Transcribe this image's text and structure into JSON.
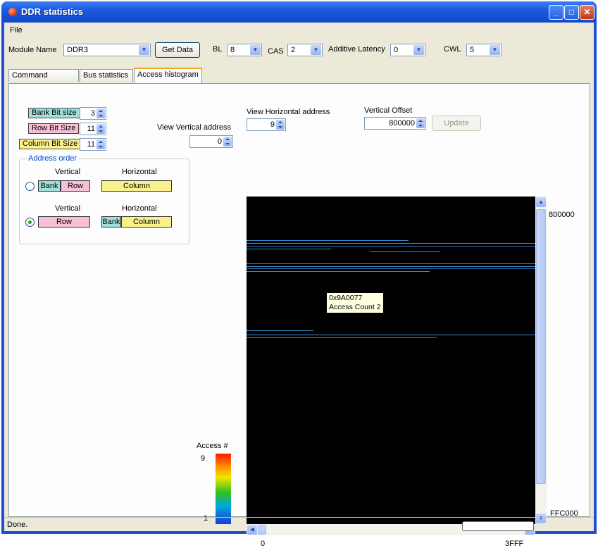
{
  "window": {
    "title": "DDR statistics"
  },
  "menu": {
    "file": "File"
  },
  "toolbar": {
    "module_label": "Module Name",
    "module_value": "DDR3",
    "get_data": "Get Data",
    "bl_label": "BL",
    "bl_value": "8",
    "cas_label": "CAS",
    "cas_value": "2",
    "al_label": "Additive Latency",
    "al_value": "0",
    "cwl_label": "CWL",
    "cwl_value": "5"
  },
  "tabs": [
    {
      "label": "Command statistics",
      "active": false
    },
    {
      "label": "Bus statistics",
      "active": false
    },
    {
      "label": "Access histogram",
      "active": true
    }
  ],
  "bits": {
    "bank_label": "Bank Bit size",
    "bank_value": "3",
    "row_label": "Row Bit Size",
    "row_value": "11",
    "col_label": "Column Bit Size",
    "col_value": "11"
  },
  "address_order": {
    "title": "Address order",
    "option1": {
      "vertical_label": "Vertical",
      "horizontal_label": "Horizontal",
      "bank": "Bank",
      "row": "Row",
      "column": "Column",
      "selected": false
    },
    "option2": {
      "vertical_label": "Vertical",
      "horizontal_label": "Horizontal",
      "row": "Row",
      "bank": "Bank",
      "column": "Column",
      "selected": true
    }
  },
  "view": {
    "vertical_label": "View Vertical address",
    "vertical_value": "0",
    "horizontal_label": "View Horizontal address",
    "horizontal_value": "9",
    "offset_label": "Vertical Offset",
    "offset_value": "800000",
    "update": "Update"
  },
  "histogram": {
    "tooltip_addr": "0x9A0077",
    "tooltip_count": "Access Count 2",
    "y_top": "800000",
    "y_bottom": "FFC000",
    "x_left": "0",
    "x_right": "3FFF"
  },
  "legend": {
    "title": "Access #",
    "max": "9",
    "min": "1"
  },
  "status": {
    "text": "Done."
  },
  "colors": {
    "title_bar": "#1a5ae0",
    "window_bg": "#ece9d8",
    "plot_bg": "#000000",
    "line": "#3a8fd8"
  }
}
